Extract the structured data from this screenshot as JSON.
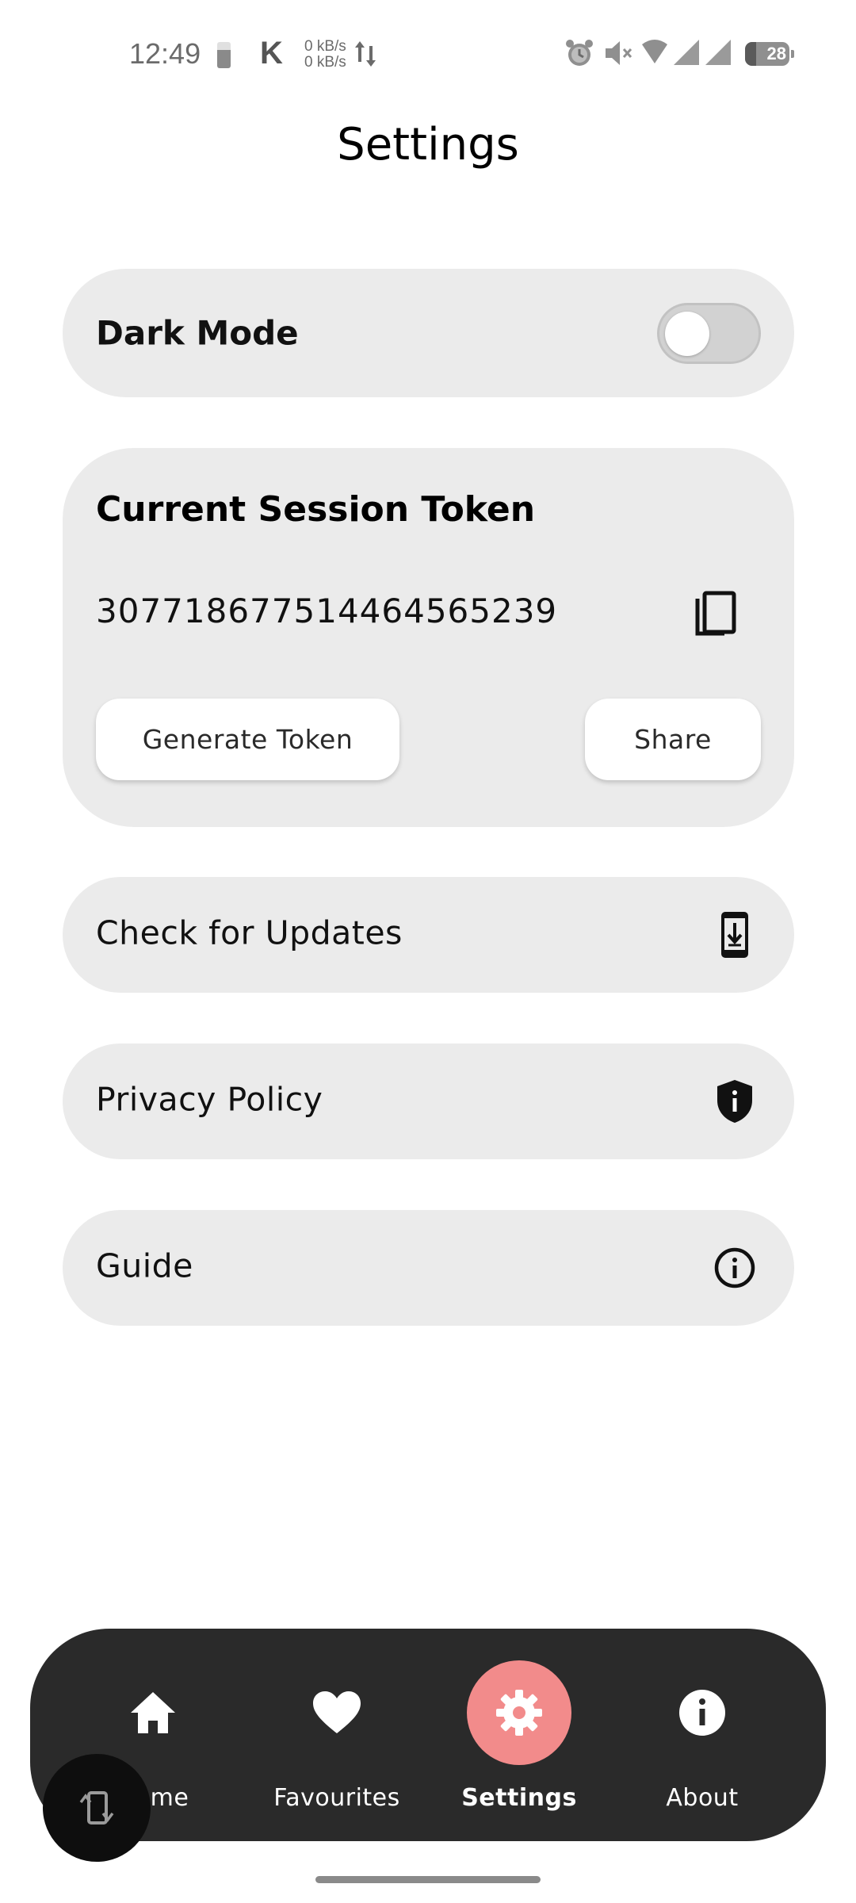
{
  "status_bar": {
    "time": "12:49",
    "carrier_icon": "K",
    "net_up": "0 kB/s",
    "net_down": "0 kB/s",
    "battery": "28",
    "icons": [
      "alarm-icon",
      "mute-icon",
      "wifi-icon",
      "signal-icon",
      "signal-icon-2",
      "battery-icon"
    ]
  },
  "page": {
    "title": "Settings"
  },
  "dark_mode": {
    "label": "Dark Mode",
    "enabled": false
  },
  "session": {
    "title": "Current Session Token",
    "token": "307718677514464565239",
    "generate_label": "Generate Token",
    "share_label": "Share"
  },
  "rows": {
    "updates": {
      "label": "Check for Updates",
      "icon": "phone-download-icon"
    },
    "privacy": {
      "label": "Privacy Policy",
      "icon": "shield-info-icon"
    },
    "guide": {
      "label": "Guide",
      "icon": "info-circle-icon"
    }
  },
  "nav": {
    "home": "Home",
    "favourites": "Favourites",
    "settings": "Settings",
    "about": "About",
    "active": "settings"
  },
  "colors": {
    "card_bg": "#ebebeb",
    "nav_bg": "#2a2a2a",
    "accent": "#f28b8b",
    "toggle_off": "#d2d2d2"
  }
}
